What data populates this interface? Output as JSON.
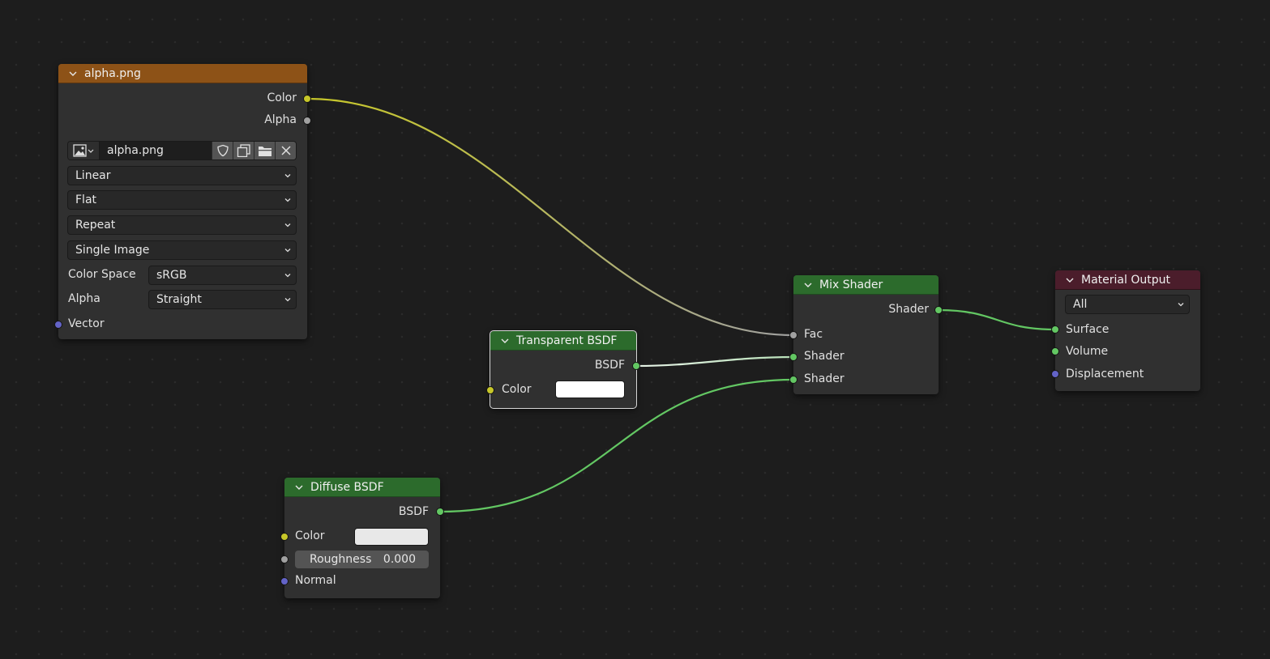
{
  "image_node": {
    "title": "alpha.png",
    "outputs": [
      "Color",
      "Alpha"
    ],
    "image_name": "alpha.png",
    "interpolation": "Linear",
    "projection": "Flat",
    "extension": "Repeat",
    "source": "Single Image",
    "color_space_label": "Color Space",
    "color_space_value": "sRGB",
    "alpha_label": "Alpha",
    "alpha_value": "Straight",
    "input_vector": "Vector"
  },
  "transparent_node": {
    "title": "Transparent BSDF",
    "output": "BSDF",
    "input_color": "Color",
    "color_value": "#ffffff"
  },
  "diffuse_node": {
    "title": "Diffuse BSDF",
    "output": "BSDF",
    "input_color": "Color",
    "color_value": "#e8e8e8",
    "roughness_label": "Roughness",
    "roughness_value": "0.000",
    "input_normal": "Normal"
  },
  "mix_node": {
    "title": "Mix Shader",
    "output": "Shader",
    "input_fac": "Fac",
    "input_shader_1": "Shader",
    "input_shader_2": "Shader"
  },
  "output_node": {
    "title": "Material Output",
    "target": "All",
    "input_surface": "Surface",
    "input_volume": "Volume",
    "input_displacement": "Displacement"
  },
  "colors": {
    "texture_header": "#8d5217",
    "shader_header": "#2c6b2c",
    "output_header": "#4b1d2b",
    "socket_color": "#c7c729",
    "socket_float": "#a1a1a1",
    "socket_shader": "#63c763",
    "socket_vector": "#6363c7"
  }
}
